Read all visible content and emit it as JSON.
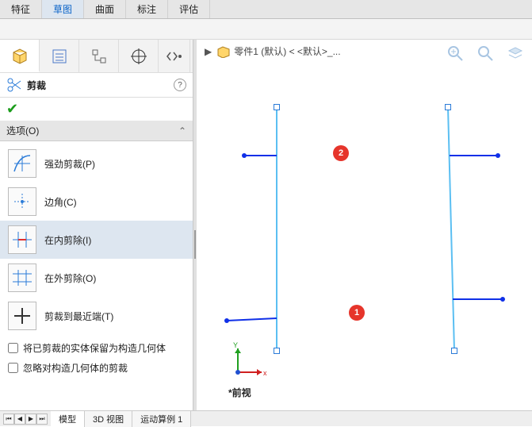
{
  "top_tabs": [
    "特征",
    "草图",
    "曲面",
    "标注",
    "评估"
  ],
  "top_active": 1,
  "breadcrumb": "零件1 (默认) < <默认>_...",
  "panel": {
    "title": "剪裁",
    "section": "选项(O)",
    "options": [
      {
        "label": "强劲剪裁(P)"
      },
      {
        "label": "边角(C)"
      },
      {
        "label": "在内剪除(I)"
      },
      {
        "label": "在外剪除(O)"
      },
      {
        "label": "剪裁到最近端(T)"
      }
    ],
    "sel": 2,
    "chk1": "将已剪裁的实体保留为构造几何体",
    "chk2": "忽略对构造几何体的剪裁"
  },
  "markers": {
    "m1": "1",
    "m2": "2"
  },
  "viewname": "*前视",
  "axes": {
    "x": "x",
    "y": "Y"
  },
  "bottom_tabs": [
    "模型",
    "3D 视图",
    "运动算例 1"
  ],
  "bottom_sel": 0
}
